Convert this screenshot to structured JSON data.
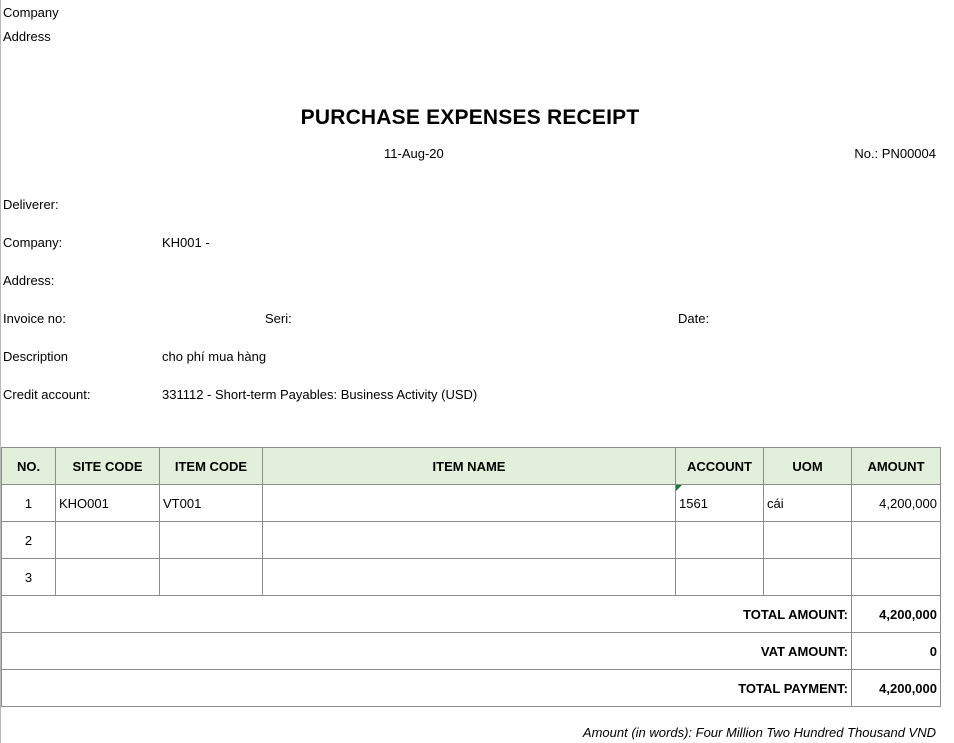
{
  "header": {
    "company_label": "Company",
    "address_label": "Address"
  },
  "title": "PURCHASE EXPENSES RECEIPT",
  "date": "11-Aug-20",
  "number": "No.: PN00004",
  "fields": {
    "deliverer_label": "Deliverer:",
    "company_label": "Company:",
    "company_value": "KH001 -",
    "address_label": "Address:",
    "invoice_label": "Invoice no:",
    "seri_label": "Seri:",
    "date_label": "Date:",
    "description_label": "Description",
    "description_value": "cho phí mua hàng",
    "credit_label": "Credit account:",
    "credit_value": "331112 - Short-term Payables: Business Activity (USD)"
  },
  "table": {
    "headers": [
      "NO.",
      "SITE CODE",
      "ITEM CODE",
      "ITEM NAME",
      "ACCOUNT",
      "UOM",
      "AMOUNT"
    ],
    "rows": [
      [
        "1",
        "KHO001",
        "VT001",
        "",
        "1561",
        "cái",
        "4,200,000"
      ],
      [
        "2",
        "",
        "",
        "",
        "",
        "",
        ""
      ],
      [
        "3",
        "",
        "",
        "",
        "",
        "",
        ""
      ]
    ]
  },
  "totals": {
    "total_amount_label": "TOTAL AMOUNT:",
    "total_amount": "4,200,000",
    "vat_label": "VAT AMOUNT:",
    "vat": "0",
    "total_payment_label": "TOTAL PAYMENT:",
    "total_payment": "4,200,000"
  },
  "amount_in_words": "Amount (in words): Four Million Two Hundred Thousand VND"
}
